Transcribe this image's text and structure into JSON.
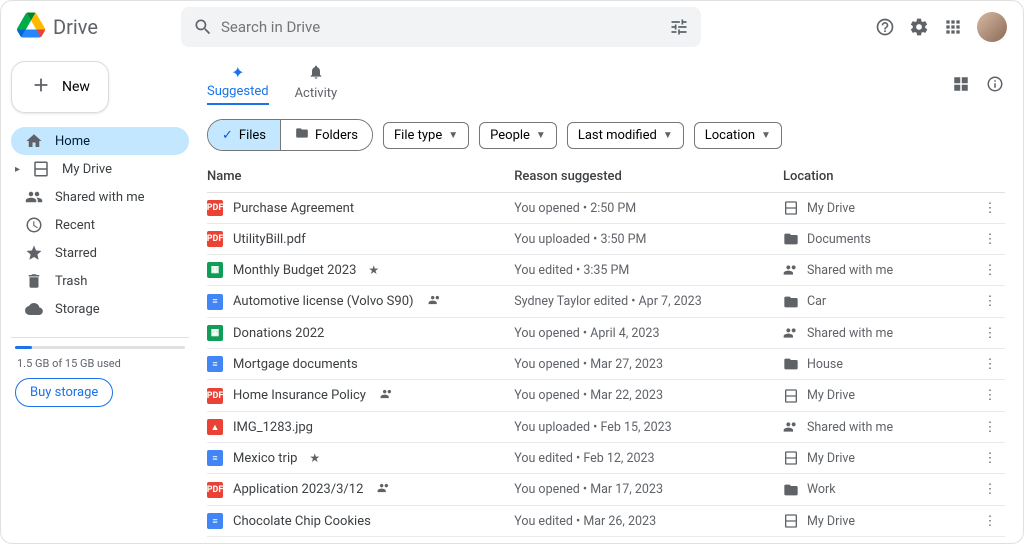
{
  "app": {
    "name": "Drive"
  },
  "search": {
    "placeholder": "Search in Drive"
  },
  "sidebar": {
    "new_label": "New",
    "items": [
      {
        "label": "Home"
      },
      {
        "label": "My Drive"
      },
      {
        "label": "Shared with me"
      },
      {
        "label": "Recent"
      },
      {
        "label": "Starred"
      },
      {
        "label": "Trash"
      },
      {
        "label": "Storage"
      }
    ],
    "storage_used": "1.5 GB of 15 GB used",
    "buy_label": "Buy storage"
  },
  "tabs": {
    "suggested": "Suggested",
    "activity": "Activity"
  },
  "toggle": {
    "files": "Files",
    "folders": "Folders"
  },
  "filters": {
    "file_type": "File type",
    "people": "People",
    "last_modified": "Last modified",
    "location": "Location"
  },
  "columns": {
    "name": "Name",
    "reason": "Reason suggested",
    "location": "Location"
  },
  "rows": [
    {
      "name": "Purchase Agreement",
      "type": "pdf",
      "starred": false,
      "shared": false,
      "reason": "You opened • 2:50 PM",
      "loc_type": "drive",
      "location": "My Drive"
    },
    {
      "name": "UtilityBill.pdf",
      "type": "pdf",
      "starred": false,
      "shared": false,
      "reason": "You uploaded • 3:50 PM",
      "loc_type": "folder",
      "location": "Documents"
    },
    {
      "name": "Monthly Budget 2023",
      "type": "sheet",
      "starred": true,
      "shared": false,
      "reason": "You edited • 3:35 PM",
      "loc_type": "shared",
      "location": "Shared with me"
    },
    {
      "name": "Automotive license (Volvo S90)",
      "type": "doc",
      "starred": false,
      "shared": true,
      "reason": "Sydney Taylor edited • Apr 7, 2023",
      "loc_type": "folder",
      "location": "Car"
    },
    {
      "name": "Donations 2022",
      "type": "sheet",
      "starred": false,
      "shared": false,
      "reason": "You opened • April 4, 2023",
      "loc_type": "shared",
      "location": "Shared with me"
    },
    {
      "name": "Mortgage documents",
      "type": "doc",
      "starred": false,
      "shared": false,
      "reason": "You opened • Mar 27, 2023",
      "loc_type": "folder",
      "location": "House"
    },
    {
      "name": "Home Insurance Policy",
      "type": "pdf",
      "starred": false,
      "shared": true,
      "reason": "You opened • Mar 22, 2023",
      "loc_type": "drive",
      "location": "My Drive"
    },
    {
      "name": "IMG_1283.jpg",
      "type": "img",
      "starred": false,
      "shared": false,
      "reason": "You uploaded • Feb 15, 2023",
      "loc_type": "shared",
      "location": "Shared with me"
    },
    {
      "name": "Mexico trip",
      "type": "doc",
      "starred": true,
      "shared": false,
      "reason": "You edited • Feb 12, 2023",
      "loc_type": "drive",
      "location": "My Drive"
    },
    {
      "name": "Application 2023/3/12",
      "type": "pdf",
      "starred": false,
      "shared": true,
      "reason": "You opened • Mar 17, 2023",
      "loc_type": "folder",
      "location": "Work"
    },
    {
      "name": "Chocolate Chip Cookies",
      "type": "doc",
      "starred": false,
      "shared": false,
      "reason": "You edited • Mar 26, 2023",
      "loc_type": "drive",
      "location": "My Drive"
    }
  ]
}
